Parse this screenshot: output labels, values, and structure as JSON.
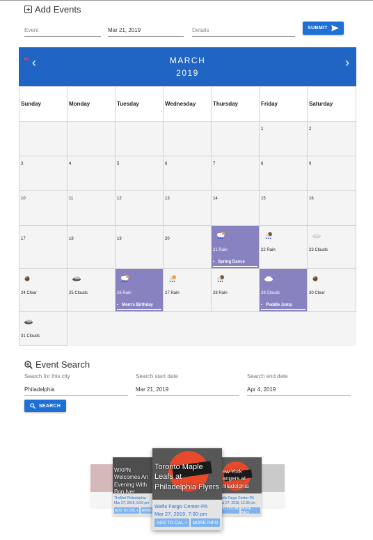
{
  "add_events": {
    "title": "Add Events",
    "event_placeholder": "Event",
    "date_value": "Mar 21, 2019",
    "details_placeholder": "Details",
    "submit_label": "SUBMIT"
  },
  "calendar": {
    "hi_label": "Hi",
    "month": "MARCH",
    "year": "2019",
    "prev_icon": "chevron-left-icon",
    "next_icon": "chevron-right-icon",
    "weekdays": [
      "Sunday",
      "Monday",
      "Tuesday",
      "Wednesday",
      "Thursday",
      "Friday",
      "Saturday"
    ],
    "days": {
      "d1": "1",
      "d2": "2",
      "d3": "3",
      "d4": "4",
      "d5": "5",
      "d6": "6",
      "d7": "7",
      "d8": "8",
      "d9": "9",
      "d10": "10",
      "d11": "11",
      "d12": "12",
      "d13": "13",
      "d14": "14",
      "d15": "15",
      "d16": "16",
      "d17": "17",
      "d18": "18",
      "d19": "19",
      "d20": "20"
    },
    "weather": {
      "w21": "21 Rain",
      "w22": "22 Rain",
      "w23": "23 Clouds",
      "w24": "24 Clear",
      "w25": "25 Clouds",
      "w26": "26 Rain",
      "w27": "27 Rain",
      "w28": "28 Rain",
      "w29": "29 Clouds",
      "w30": "30 Clear",
      "w31": "31 Clouds"
    },
    "events": {
      "e21": "Spring Dance",
      "e26": "Mom's Birthday",
      "e29": "Puddle Jump"
    },
    "highlight_color": "#8882c0",
    "header_color": "#2064c4"
  },
  "event_search": {
    "title": "Event Search",
    "city_label": "Search for this city",
    "city_value": "Philadelphia",
    "start_label": "Search start date",
    "start_value": "Mar 21, 2019",
    "end_label": "Search end date",
    "end_value": "Apr 4, 2019",
    "search_label": "SEARCH"
  },
  "carousel": {
    "main": {
      "title": "Toronto Maple Leafs at Philadelphia Flyers",
      "venue": "Wells Fargo Center-PA",
      "date": "Mar 27, 2019, 7:00 pm",
      "add_label": "ADD TO CAL +",
      "more_label": "MORE INFO"
    },
    "left": {
      "title": "WXPN Welcomes An Evening With Bon Iver",
      "venue": "TheMet Philadelphia",
      "date": "Mar 27, 2019, 8:00 pm",
      "add_label": "ADD TO CAL +",
      "more_label": "MORE"
    },
    "right": {
      "title": "New York Rangers at Philadelphia",
      "venue": "Wells Fargo Center-PA",
      "date": "Mar 27, 2019, 12:30 pm",
      "add_label": "ADD TO CAL +",
      "more_label": "MORE INFO"
    }
  }
}
